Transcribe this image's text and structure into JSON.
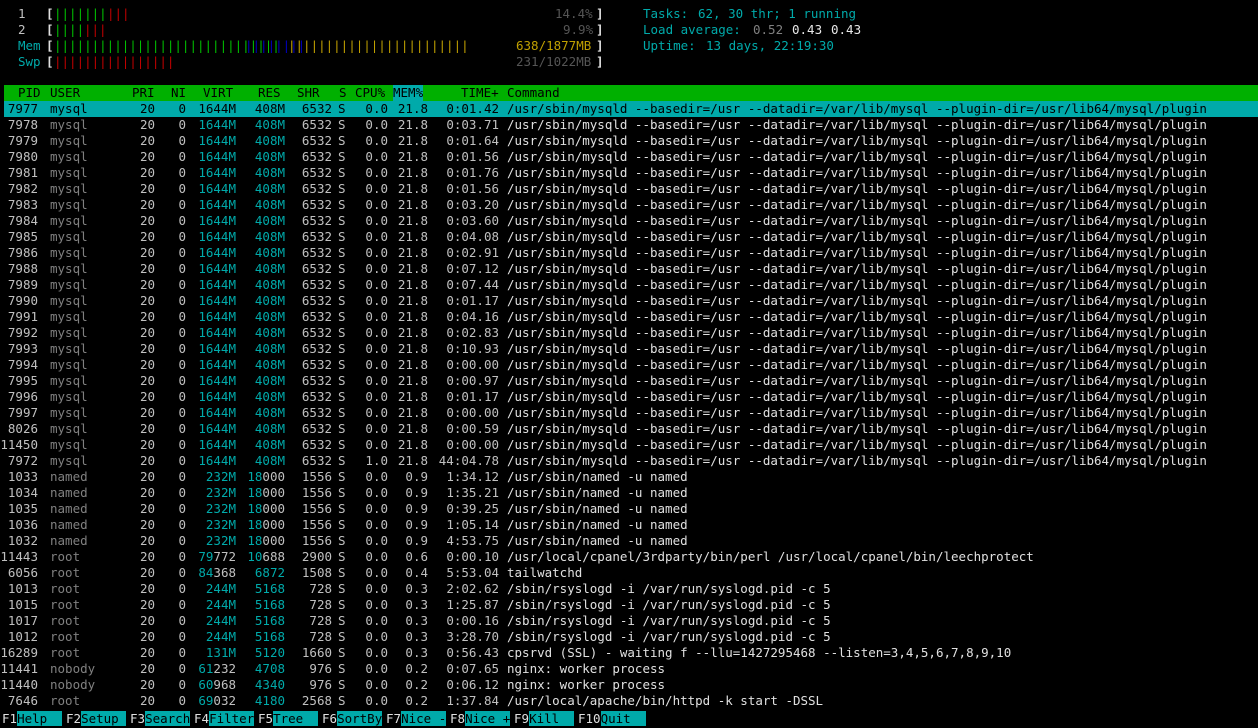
{
  "meters": {
    "cpu1": {
      "label": "1",
      "bar_green": "|||||||",
      "bar_red": "|||",
      "pct": "14.4%"
    },
    "cpu2": {
      "label": "2",
      "bar_green": "||||",
      "bar_red": "|||",
      "pct": "9.9%"
    },
    "mem": {
      "label": "Mem",
      "bar_green": "||||||||||||||||||||||||||||||",
      "bar_blue": "||||||||",
      "bar_yellow": "||||||||||||||||||||||||",
      "value": "638/1877MB"
    },
    "swp": {
      "label": "Swp",
      "bar_red": "||||||||||||||||",
      "value": "231/1022MB"
    }
  },
  "summary": {
    "tasks_label": "Tasks:",
    "tasks_value": "62, 30 thr; 1 running",
    "load_label": "Load average:",
    "load1": "0.52",
    "load5": "0.43",
    "load15": "0.43",
    "uptime_label": "Uptime:",
    "uptime_value": "13 days, 22:19:30"
  },
  "columns": {
    "pid": "PID",
    "user": "USER",
    "pri": "PRI",
    "ni": "NI",
    "virt": "VIRT",
    "res": "RES",
    "shr": "SHR",
    "s": "S",
    "cpu": "CPU%",
    "mem": "MEM%",
    "time": "TIME+",
    "cmd": "Command"
  },
  "processes": [
    {
      "pid": "7977",
      "user": "mysql",
      "pri": "20",
      "ni": "0",
      "virt": "1644M",
      "res": "408M",
      "shr": "6532",
      "s": "S",
      "cpu": "0.0",
      "mem": "21.8",
      "time": "0:01.42",
      "cmd": "/usr/sbin/mysqld --basedir=/usr --datadir=/var/lib/mysql --plugin-dir=/usr/lib64/mysql/plugin"
    },
    {
      "pid": "7978",
      "user": "mysql",
      "pri": "20",
      "ni": "0",
      "virt": "1644M",
      "res": "408M",
      "shr": "6532",
      "s": "S",
      "cpu": "0.0",
      "mem": "21.8",
      "time": "0:03.71",
      "cmd": "/usr/sbin/mysqld --basedir=/usr --datadir=/var/lib/mysql --plugin-dir=/usr/lib64/mysql/plugin"
    },
    {
      "pid": "7979",
      "user": "mysql",
      "pri": "20",
      "ni": "0",
      "virt": "1644M",
      "res": "408M",
      "shr": "6532",
      "s": "S",
      "cpu": "0.0",
      "mem": "21.8",
      "time": "0:01.64",
      "cmd": "/usr/sbin/mysqld --basedir=/usr --datadir=/var/lib/mysql --plugin-dir=/usr/lib64/mysql/plugin"
    },
    {
      "pid": "7980",
      "user": "mysql",
      "pri": "20",
      "ni": "0",
      "virt": "1644M",
      "res": "408M",
      "shr": "6532",
      "s": "S",
      "cpu": "0.0",
      "mem": "21.8",
      "time": "0:01.56",
      "cmd": "/usr/sbin/mysqld --basedir=/usr --datadir=/var/lib/mysql --plugin-dir=/usr/lib64/mysql/plugin"
    },
    {
      "pid": "7981",
      "user": "mysql",
      "pri": "20",
      "ni": "0",
      "virt": "1644M",
      "res": "408M",
      "shr": "6532",
      "s": "S",
      "cpu": "0.0",
      "mem": "21.8",
      "time": "0:01.76",
      "cmd": "/usr/sbin/mysqld --basedir=/usr --datadir=/var/lib/mysql --plugin-dir=/usr/lib64/mysql/plugin"
    },
    {
      "pid": "7982",
      "user": "mysql",
      "pri": "20",
      "ni": "0",
      "virt": "1644M",
      "res": "408M",
      "shr": "6532",
      "s": "S",
      "cpu": "0.0",
      "mem": "21.8",
      "time": "0:01.56",
      "cmd": "/usr/sbin/mysqld --basedir=/usr --datadir=/var/lib/mysql --plugin-dir=/usr/lib64/mysql/plugin"
    },
    {
      "pid": "7983",
      "user": "mysql",
      "pri": "20",
      "ni": "0",
      "virt": "1644M",
      "res": "408M",
      "shr": "6532",
      "s": "S",
      "cpu": "0.0",
      "mem": "21.8",
      "time": "0:03.20",
      "cmd": "/usr/sbin/mysqld --basedir=/usr --datadir=/var/lib/mysql --plugin-dir=/usr/lib64/mysql/plugin"
    },
    {
      "pid": "7984",
      "user": "mysql",
      "pri": "20",
      "ni": "0",
      "virt": "1644M",
      "res": "408M",
      "shr": "6532",
      "s": "S",
      "cpu": "0.0",
      "mem": "21.8",
      "time": "0:03.60",
      "cmd": "/usr/sbin/mysqld --basedir=/usr --datadir=/var/lib/mysql --plugin-dir=/usr/lib64/mysql/plugin"
    },
    {
      "pid": "7985",
      "user": "mysql",
      "pri": "20",
      "ni": "0",
      "virt": "1644M",
      "res": "408M",
      "shr": "6532",
      "s": "S",
      "cpu": "0.0",
      "mem": "21.8",
      "time": "0:04.08",
      "cmd": "/usr/sbin/mysqld --basedir=/usr --datadir=/var/lib/mysql --plugin-dir=/usr/lib64/mysql/plugin"
    },
    {
      "pid": "7986",
      "user": "mysql",
      "pri": "20",
      "ni": "0",
      "virt": "1644M",
      "res": "408M",
      "shr": "6532",
      "s": "S",
      "cpu": "0.0",
      "mem": "21.8",
      "time": "0:02.91",
      "cmd": "/usr/sbin/mysqld --basedir=/usr --datadir=/var/lib/mysql --plugin-dir=/usr/lib64/mysql/plugin"
    },
    {
      "pid": "7988",
      "user": "mysql",
      "pri": "20",
      "ni": "0",
      "virt": "1644M",
      "res": "408M",
      "shr": "6532",
      "s": "S",
      "cpu": "0.0",
      "mem": "21.8",
      "time": "0:07.12",
      "cmd": "/usr/sbin/mysqld --basedir=/usr --datadir=/var/lib/mysql --plugin-dir=/usr/lib64/mysql/plugin"
    },
    {
      "pid": "7989",
      "user": "mysql",
      "pri": "20",
      "ni": "0",
      "virt": "1644M",
      "res": "408M",
      "shr": "6532",
      "s": "S",
      "cpu": "0.0",
      "mem": "21.8",
      "time": "0:07.44",
      "cmd": "/usr/sbin/mysqld --basedir=/usr --datadir=/var/lib/mysql --plugin-dir=/usr/lib64/mysql/plugin"
    },
    {
      "pid": "7990",
      "user": "mysql",
      "pri": "20",
      "ni": "0",
      "virt": "1644M",
      "res": "408M",
      "shr": "6532",
      "s": "S",
      "cpu": "0.0",
      "mem": "21.8",
      "time": "0:01.17",
      "cmd": "/usr/sbin/mysqld --basedir=/usr --datadir=/var/lib/mysql --plugin-dir=/usr/lib64/mysql/plugin"
    },
    {
      "pid": "7991",
      "user": "mysql",
      "pri": "20",
      "ni": "0",
      "virt": "1644M",
      "res": "408M",
      "shr": "6532",
      "s": "S",
      "cpu": "0.0",
      "mem": "21.8",
      "time": "0:04.16",
      "cmd": "/usr/sbin/mysqld --basedir=/usr --datadir=/var/lib/mysql --plugin-dir=/usr/lib64/mysql/plugin"
    },
    {
      "pid": "7992",
      "user": "mysql",
      "pri": "20",
      "ni": "0",
      "virt": "1644M",
      "res": "408M",
      "shr": "6532",
      "s": "S",
      "cpu": "0.0",
      "mem": "21.8",
      "time": "0:02.83",
      "cmd": "/usr/sbin/mysqld --basedir=/usr --datadir=/var/lib/mysql --plugin-dir=/usr/lib64/mysql/plugin"
    },
    {
      "pid": "7993",
      "user": "mysql",
      "pri": "20",
      "ni": "0",
      "virt": "1644M",
      "res": "408M",
      "shr": "6532",
      "s": "S",
      "cpu": "0.0",
      "mem": "21.8",
      "time": "0:10.93",
      "cmd": "/usr/sbin/mysqld --basedir=/usr --datadir=/var/lib/mysql --plugin-dir=/usr/lib64/mysql/plugin"
    },
    {
      "pid": "7994",
      "user": "mysql",
      "pri": "20",
      "ni": "0",
      "virt": "1644M",
      "res": "408M",
      "shr": "6532",
      "s": "S",
      "cpu": "0.0",
      "mem": "21.8",
      "time": "0:00.00",
      "cmd": "/usr/sbin/mysqld --basedir=/usr --datadir=/var/lib/mysql --plugin-dir=/usr/lib64/mysql/plugin"
    },
    {
      "pid": "7995",
      "user": "mysql",
      "pri": "20",
      "ni": "0",
      "virt": "1644M",
      "res": "408M",
      "shr": "6532",
      "s": "S",
      "cpu": "0.0",
      "mem": "21.8",
      "time": "0:00.97",
      "cmd": "/usr/sbin/mysqld --basedir=/usr --datadir=/var/lib/mysql --plugin-dir=/usr/lib64/mysql/plugin"
    },
    {
      "pid": "7996",
      "user": "mysql",
      "pri": "20",
      "ni": "0",
      "virt": "1644M",
      "res": "408M",
      "shr": "6532",
      "s": "S",
      "cpu": "0.0",
      "mem": "21.8",
      "time": "0:01.17",
      "cmd": "/usr/sbin/mysqld --basedir=/usr --datadir=/var/lib/mysql --plugin-dir=/usr/lib64/mysql/plugin"
    },
    {
      "pid": "7997",
      "user": "mysql",
      "pri": "20",
      "ni": "0",
      "virt": "1644M",
      "res": "408M",
      "shr": "6532",
      "s": "S",
      "cpu": "0.0",
      "mem": "21.8",
      "time": "0:00.00",
      "cmd": "/usr/sbin/mysqld --basedir=/usr --datadir=/var/lib/mysql --plugin-dir=/usr/lib64/mysql/plugin"
    },
    {
      "pid": "8026",
      "user": "mysql",
      "pri": "20",
      "ni": "0",
      "virt": "1644M",
      "res": "408M",
      "shr": "6532",
      "s": "S",
      "cpu": "0.0",
      "mem": "21.8",
      "time": "0:00.59",
      "cmd": "/usr/sbin/mysqld --basedir=/usr --datadir=/var/lib/mysql --plugin-dir=/usr/lib64/mysql/plugin"
    },
    {
      "pid": "11450",
      "user": "mysql",
      "pri": "20",
      "ni": "0",
      "virt": "1644M",
      "res": "408M",
      "shr": "6532",
      "s": "S",
      "cpu": "0.0",
      "mem": "21.8",
      "time": "0:00.00",
      "cmd": "/usr/sbin/mysqld --basedir=/usr --datadir=/var/lib/mysql --plugin-dir=/usr/lib64/mysql/plugin"
    },
    {
      "pid": "7972",
      "user": "mysql",
      "pri": "20",
      "ni": "0",
      "virt": "1644M",
      "res": "408M",
      "shr": "6532",
      "s": "S",
      "cpu": "1.0",
      "mem": "21.8",
      "time": "44:04.78",
      "cmd": "/usr/sbin/mysqld --basedir=/usr --datadir=/var/lib/mysql --plugin-dir=/usr/lib64/mysql/plugin"
    },
    {
      "pid": "1033",
      "user": "named",
      "pri": "20",
      "ni": "0",
      "virt": "232M",
      "res": "18000",
      "shr": "1556",
      "s": "S",
      "cpu": "0.0",
      "mem": "0.9",
      "time": "1:34.12",
      "cmd": "/usr/sbin/named -u named"
    },
    {
      "pid": "1034",
      "user": "named",
      "pri": "20",
      "ni": "0",
      "virt": "232M",
      "res": "18000",
      "shr": "1556",
      "s": "S",
      "cpu": "0.0",
      "mem": "0.9",
      "time": "1:35.21",
      "cmd": "/usr/sbin/named -u named"
    },
    {
      "pid": "1035",
      "user": "named",
      "pri": "20",
      "ni": "0",
      "virt": "232M",
      "res": "18000",
      "shr": "1556",
      "s": "S",
      "cpu": "0.0",
      "mem": "0.9",
      "time": "0:39.25",
      "cmd": "/usr/sbin/named -u named"
    },
    {
      "pid": "1036",
      "user": "named",
      "pri": "20",
      "ni": "0",
      "virt": "232M",
      "res": "18000",
      "shr": "1556",
      "s": "S",
      "cpu": "0.0",
      "mem": "0.9",
      "time": "1:05.14",
      "cmd": "/usr/sbin/named -u named"
    },
    {
      "pid": "1032",
      "user": "named",
      "pri": "20",
      "ni": "0",
      "virt": "232M",
      "res": "18000",
      "shr": "1556",
      "s": "S",
      "cpu": "0.0",
      "mem": "0.9",
      "time": "4:53.75",
      "cmd": "/usr/sbin/named -u named"
    },
    {
      "pid": "11443",
      "user": "root",
      "pri": "20",
      "ni": "0",
      "virt": "79772",
      "res": "10688",
      "shr": "2900",
      "s": "S",
      "cpu": "0.0",
      "mem": "0.6",
      "time": "0:00.10",
      "cmd": "/usr/local/cpanel/3rdparty/bin/perl /usr/local/cpanel/bin/leechprotect"
    },
    {
      "pid": "6056",
      "user": "root",
      "pri": "20",
      "ni": "0",
      "virt": "84368",
      "res": "6872",
      "shr": "1508",
      "s": "S",
      "cpu": "0.0",
      "mem": "0.4",
      "time": "5:53.04",
      "cmd": "tailwatchd"
    },
    {
      "pid": "1013",
      "user": "root",
      "pri": "20",
      "ni": "0",
      "virt": "244M",
      "res": "5168",
      "shr": "728",
      "s": "S",
      "cpu": "0.0",
      "mem": "0.3",
      "time": "2:02.62",
      "cmd": "/sbin/rsyslogd -i /var/run/syslogd.pid -c 5"
    },
    {
      "pid": "1015",
      "user": "root",
      "pri": "20",
      "ni": "0",
      "virt": "244M",
      "res": "5168",
      "shr": "728",
      "s": "S",
      "cpu": "0.0",
      "mem": "0.3",
      "time": "1:25.87",
      "cmd": "/sbin/rsyslogd -i /var/run/syslogd.pid -c 5"
    },
    {
      "pid": "1017",
      "user": "root",
      "pri": "20",
      "ni": "0",
      "virt": "244M",
      "res": "5168",
      "shr": "728",
      "s": "S",
      "cpu": "0.0",
      "mem": "0.3",
      "time": "0:00.16",
      "cmd": "/sbin/rsyslogd -i /var/run/syslogd.pid -c 5"
    },
    {
      "pid": "1012",
      "user": "root",
      "pri": "20",
      "ni": "0",
      "virt": "244M",
      "res": "5168",
      "shr": "728",
      "s": "S",
      "cpu": "0.0",
      "mem": "0.3",
      "time": "3:28.70",
      "cmd": "/sbin/rsyslogd -i /var/run/syslogd.pid -c 5"
    },
    {
      "pid": "16289",
      "user": "root",
      "pri": "20",
      "ni": "0",
      "virt": "131M",
      "res": "5120",
      "shr": "1660",
      "s": "S",
      "cpu": "0.0",
      "mem": "0.3",
      "time": "0:56.43",
      "cmd": "cpsrvd (SSL) - waiting f --llu=1427295468 --listen=3,4,5,6,7,8,9,10"
    },
    {
      "pid": "11441",
      "user": "nobody",
      "pri": "20",
      "ni": "0",
      "virt": "61232",
      "res": "4708",
      "shr": "976",
      "s": "S",
      "cpu": "0.0",
      "mem": "0.2",
      "time": "0:07.65",
      "cmd": "nginx: worker process"
    },
    {
      "pid": "11440",
      "user": "nobody",
      "pri": "20",
      "ni": "0",
      "virt": "60968",
      "res": "4340",
      "shr": "976",
      "s": "S",
      "cpu": "0.0",
      "mem": "0.2",
      "time": "0:06.12",
      "cmd": "nginx: worker process"
    },
    {
      "pid": "7646",
      "user": "root",
      "pri": "20",
      "ni": "0",
      "virt": "69032",
      "res": "4180",
      "shr": "2568",
      "s": "S",
      "cpu": "0.0",
      "mem": "0.2",
      "time": "1:37.84",
      "cmd": "/usr/local/apache/bin/httpd -k start -DSSL"
    }
  ],
  "footer": [
    {
      "key": "F1",
      "label": "Help  "
    },
    {
      "key": "F2",
      "label": "Setup "
    },
    {
      "key": "F3",
      "label": "Search"
    },
    {
      "key": "F4",
      "label": "Filter"
    },
    {
      "key": "F5",
      "label": "Tree  "
    },
    {
      "key": "F6",
      "label": "SortBy"
    },
    {
      "key": "F7",
      "label": "Nice -"
    },
    {
      "key": "F8",
      "label": "Nice +"
    },
    {
      "key": "F9",
      "label": "Kill  "
    },
    {
      "key": "F10",
      "label": "Quit  "
    }
  ],
  "colors": {
    "header_bg": "#00b000",
    "selected_bg": "#00aaaa",
    "cyan": "#00aaaa"
  }
}
